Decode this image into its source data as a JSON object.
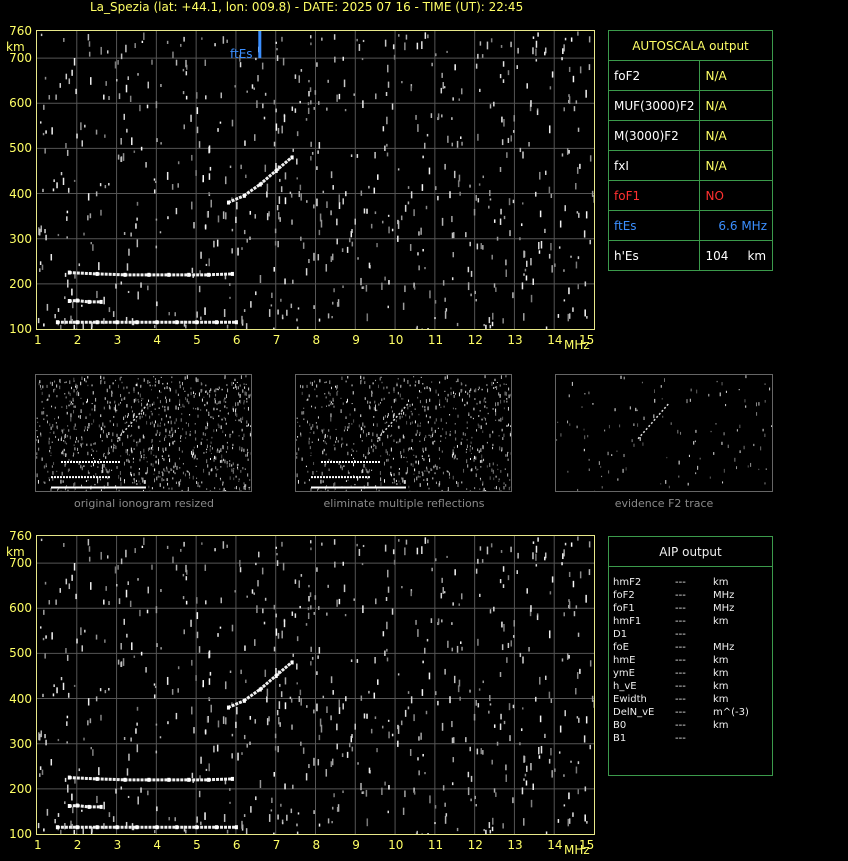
{
  "title": "La_Spezia (lat: +44.1, lon: 009.8) - DATE: 2025 07 16 - TIME (UT): 22:45",
  "axis": {
    "y_unit": "km",
    "x_unit": "MHz",
    "y_ticks": [
      "760",
      "700",
      "600",
      "500",
      "400",
      "300",
      "200",
      "100"
    ],
    "x_ticks": [
      "1",
      "2",
      "3",
      "4",
      "5",
      "6",
      "7",
      "8",
      "9",
      "10",
      "11",
      "12",
      "13",
      "14",
      "15"
    ]
  },
  "ftEs_marker_label": "ftEs",
  "autoscala": {
    "title": "AUTOSCALA output",
    "rows": [
      {
        "label": "foF2",
        "value": "N/A",
        "color": "#ffffff",
        "vcolor": "#ffff66"
      },
      {
        "label": "MUF(3000)F2",
        "value": "N/A",
        "color": "#ffffff",
        "vcolor": "#ffff66"
      },
      {
        "label": "M(3000)F2",
        "value": "N/A",
        "color": "#ffffff",
        "vcolor": "#ffff66"
      },
      {
        "label": "fxI",
        "value": "N/A",
        "color": "#ffffff",
        "vcolor": "#ffff66"
      },
      {
        "label": "foF1",
        "value": "NO",
        "color": "#ff3030",
        "vcolor": "#ff3030"
      },
      {
        "label": "ftEs",
        "value": "6.6 MHz",
        "color": "#3b8fff",
        "vcolor": "#3b8fff"
      },
      {
        "label": "h'Es",
        "value": "104     km",
        "color": "#ffffff",
        "vcolor": "#ffffff"
      }
    ]
  },
  "thumb_captions": [
    "original ionogram resized",
    "eliminate multiple reflections",
    "evidence F2 trace"
  ],
  "aip": {
    "title": "AIP output",
    "rows": [
      {
        "label": "hmF2",
        "val": "---",
        "unit": "km"
      },
      {
        "label": "foF2",
        "val": "---",
        "unit": "MHz"
      },
      {
        "label": "foF1",
        "val": "---",
        "unit": "MHz"
      },
      {
        "label": "hmF1",
        "val": "---",
        "unit": "km"
      },
      {
        "label": "D1",
        "val": "---",
        "unit": ""
      },
      {
        "label": "foE",
        "val": "---",
        "unit": "MHz"
      },
      {
        "label": "hmE",
        "val": "---",
        "unit": "km"
      },
      {
        "label": "ymE",
        "val": "---",
        "unit": "km"
      },
      {
        "label": "h_vE",
        "val": "---",
        "unit": "km"
      },
      {
        "label": "Ewidth",
        "val": "---",
        "unit": "km"
      },
      {
        "label": "DelN_vE",
        "val": "---",
        "unit": "m^(-3)"
      },
      {
        "label": "B0",
        "val": "---",
        "unit": "km"
      },
      {
        "label": "B1",
        "val": "---",
        "unit": ""
      }
    ]
  },
  "chart_data": {
    "type": "scatter",
    "xlim": [
      1,
      15
    ],
    "ylim": [
      100,
      760
    ],
    "grid": true,
    "ftEs_MHz": 6.6,
    "traces": [
      {
        "name": "",
        "x": [
          1.5,
          2.0,
          2.5,
          3.0,
          3.5,
          4.0,
          4.5,
          5.0,
          5.5,
          6.0
        ],
        "y": [
          115,
          115,
          115,
          115,
          115,
          115,
          115,
          115,
          115,
          115
        ]
      },
      {
        "name": "",
        "x": [
          1.8,
          2.0,
          2.3,
          2.6
        ],
        "y": [
          162,
          163,
          160,
          160
        ]
      },
      {
        "name": "",
        "x": [
          1.8,
          2.5,
          3.2,
          3.8,
          4.3,
          4.8,
          5.3,
          5.9
        ],
        "y": [
          225,
          222,
          220,
          220,
          220,
          220,
          220,
          222
        ]
      },
      {
        "name": "",
        "x": [
          5.8,
          6.2,
          6.6,
          7.0,
          7.4
        ],
        "y": [
          380,
          395,
          420,
          450,
          480
        ]
      }
    ]
  }
}
